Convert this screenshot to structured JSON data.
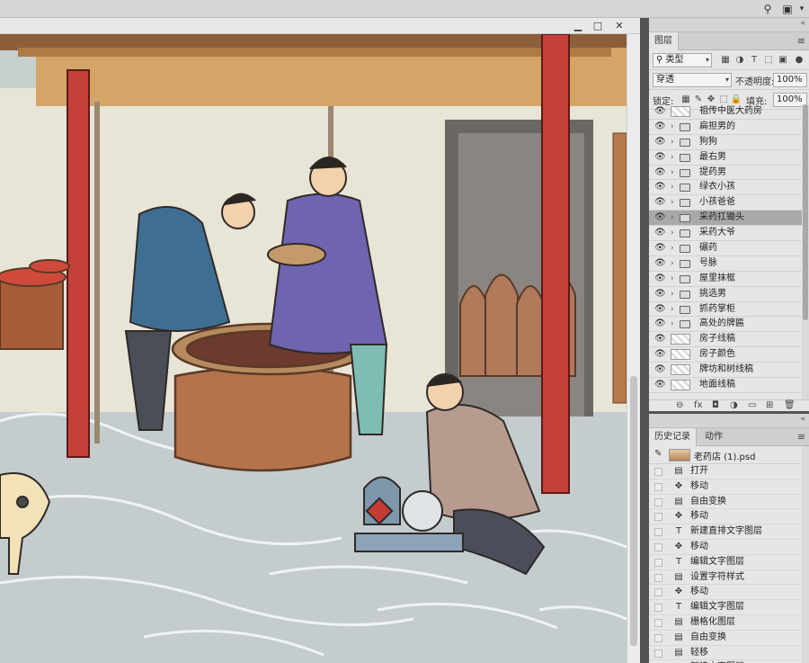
{
  "topbar": {
    "search_icon": "search-icon",
    "workspace_icon": "workspace-icon",
    "dropdown_icon": "chevron-down-icon"
  },
  "document": {
    "window_buttons": {
      "minimize": "▁",
      "restore": "□",
      "close": "✕"
    }
  },
  "layers_panel": {
    "tab_label": "图层",
    "filter_kind": "类型",
    "blend_mode": "穿透",
    "opacity_label": "不透明度:",
    "opacity_value": "100%",
    "lock_label": "锁定:",
    "fill_label": "填充:",
    "fill_value": "100%",
    "layers": [
      {
        "name": "祖传中医大药房",
        "kind": "raster"
      },
      {
        "name": "扁担男的",
        "kind": "group"
      },
      {
        "name": "狗狗",
        "kind": "group"
      },
      {
        "name": "最右男",
        "kind": "group"
      },
      {
        "name": "提药男",
        "kind": "group"
      },
      {
        "name": "绿衣小孩",
        "kind": "group"
      },
      {
        "name": "小孩爸爸",
        "kind": "group"
      },
      {
        "name": "采药扛锄头",
        "kind": "group",
        "selected": true
      },
      {
        "name": "采药大爷",
        "kind": "group"
      },
      {
        "name": "碾药",
        "kind": "group"
      },
      {
        "name": "号脉",
        "kind": "group"
      },
      {
        "name": "屋里抹框",
        "kind": "group"
      },
      {
        "name": "挑选男",
        "kind": "group"
      },
      {
        "name": "抓药掌柜",
        "kind": "group"
      },
      {
        "name": "高处的牌匾",
        "kind": "group"
      },
      {
        "name": "房子线稿",
        "kind": "raster"
      },
      {
        "name": "房子颜色",
        "kind": "raster"
      },
      {
        "name": "牌坊和树线稿",
        "kind": "raster"
      },
      {
        "name": "地面线稿",
        "kind": "raster"
      }
    ],
    "footer_icons": [
      "link-icon",
      "fx-icon",
      "mask-icon",
      "adjustment-icon",
      "folder-icon",
      "new-layer-icon",
      "trash-icon"
    ],
    "footer_glyphs": [
      "⊖",
      "fx",
      "◘",
      "◑",
      "▭",
      "⊞",
      "🗑"
    ]
  },
  "history_panel": {
    "tabs": [
      "历史记录",
      "动作"
    ],
    "snapshot_name": "老药店 (1).psd",
    "steps": [
      {
        "name": "打开",
        "icon": "document-icon",
        "glyph": "▤"
      },
      {
        "name": "移动",
        "icon": "move-icon",
        "glyph": "✥"
      },
      {
        "name": "自由变换",
        "icon": "document-icon",
        "glyph": "▤"
      },
      {
        "name": "移动",
        "icon": "move-icon",
        "glyph": "✥"
      },
      {
        "name": "新建直排文字图层",
        "icon": "type-icon",
        "glyph": "T"
      },
      {
        "name": "移动",
        "icon": "move-icon",
        "glyph": "✥"
      },
      {
        "name": "编辑文字图层",
        "icon": "type-icon",
        "glyph": "T"
      },
      {
        "name": "设置字符样式",
        "icon": "document-icon",
        "glyph": "▤"
      },
      {
        "name": "移动",
        "icon": "move-icon",
        "glyph": "✥"
      },
      {
        "name": "编辑文字图层",
        "icon": "type-icon",
        "glyph": "T"
      },
      {
        "name": "栅格化图层",
        "icon": "document-icon",
        "glyph": "▤"
      },
      {
        "name": "自由变换",
        "icon": "document-icon",
        "glyph": "▤"
      },
      {
        "name": "轻移",
        "icon": "document-icon",
        "glyph": "▤"
      },
      {
        "name": "新建文字图层",
        "icon": "type-icon",
        "glyph": "T"
      }
    ]
  }
}
